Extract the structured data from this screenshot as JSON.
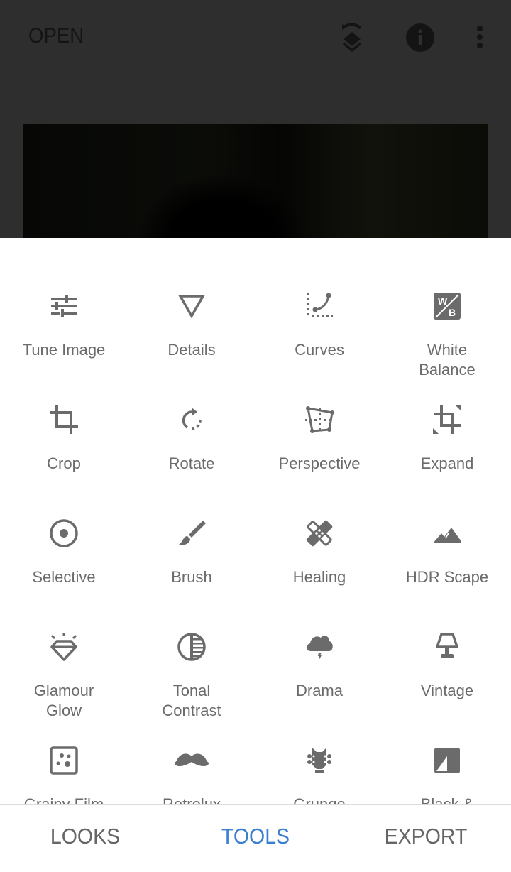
{
  "topbar": {
    "open_label": "OPEN",
    "icons": [
      "undo-layers-icon",
      "info-icon",
      "more-vert-icon"
    ]
  },
  "tools": [
    {
      "label": "Tune Image",
      "icon": "tune-sliders-icon"
    },
    {
      "label": "Details",
      "icon": "details-triangle-icon"
    },
    {
      "label": "Curves",
      "icon": "curves-icon"
    },
    {
      "label": "White\nBalance",
      "icon": "white-balance-icon"
    },
    {
      "label": "Crop",
      "icon": "crop-icon"
    },
    {
      "label": "Rotate",
      "icon": "rotate-icon"
    },
    {
      "label": "Perspective",
      "icon": "perspective-icon"
    },
    {
      "label": "Expand",
      "icon": "expand-icon"
    },
    {
      "label": "Selective",
      "icon": "selective-icon"
    },
    {
      "label": "Brush",
      "icon": "brush-icon"
    },
    {
      "label": "Healing",
      "icon": "healing-bandage-icon"
    },
    {
      "label": "HDR Scape",
      "icon": "mountains-icon"
    },
    {
      "label": "Glamour\nGlow",
      "icon": "diamond-glow-icon"
    },
    {
      "label": "Tonal\nContrast",
      "icon": "tonal-contrast-icon"
    },
    {
      "label": "Drama",
      "icon": "storm-cloud-icon"
    },
    {
      "label": "Vintage",
      "icon": "lamp-icon"
    },
    {
      "label": "Grainy Film",
      "icon": "grainy-film-icon"
    },
    {
      "label": "Retrolux",
      "icon": "mustache-icon"
    },
    {
      "label": "Grunge",
      "icon": "guitar-head-icon"
    },
    {
      "label": "Black &",
      "icon": "black-white-icon"
    }
  ],
  "bottom_tabs": [
    {
      "label": "LOOKS",
      "active": false
    },
    {
      "label": "TOOLS",
      "active": true
    },
    {
      "label": "EXPORT",
      "active": false
    }
  ],
  "colors": {
    "accent": "#3a7fd1",
    "icon": "#6b6b6b",
    "overlay": "#2e2e2e"
  }
}
